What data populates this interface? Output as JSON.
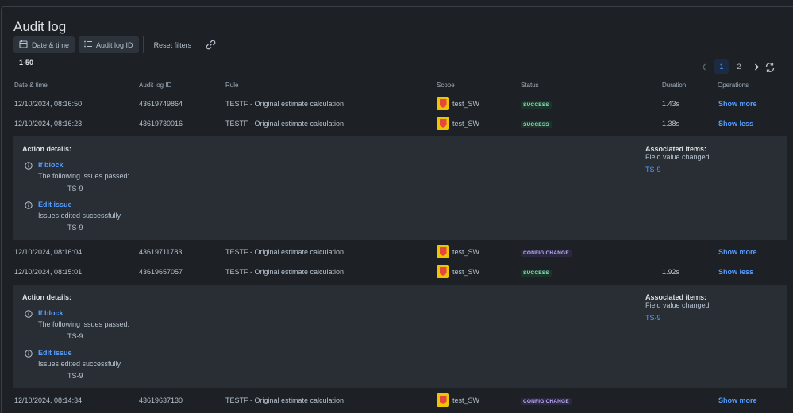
{
  "page_title": "Audit log",
  "toolbar": {
    "date_time_label": "Date & time",
    "audit_id_label": "Audit log ID",
    "reset_label": "Reset filters"
  },
  "range": "1-50",
  "pager": {
    "pages": [
      "1",
      "2"
    ],
    "current": "1"
  },
  "columns": {
    "date": "Date & time",
    "id": "Audit log ID",
    "rule": "Rule",
    "scope": "Scope",
    "status": "Status",
    "duration": "Duration",
    "operations": "Operations"
  },
  "rows": [
    {
      "date": "12/10/2024, 08:16:50",
      "id": "43619749864",
      "rule": "TESTF - Original estimate calculation",
      "scope": "test_SW",
      "status": "SUCCESS",
      "duration": "1.43s",
      "op": "Show more"
    },
    {
      "date": "12/10/2024, 08:16:23",
      "id": "43619730016",
      "rule": "TESTF - Original estimate calculation",
      "scope": "test_SW",
      "status": "SUCCESS",
      "duration": "1.38s",
      "op": "Show less"
    },
    {
      "date": "12/10/2024, 08:16:04",
      "id": "43619711783",
      "rule": "TESTF - Original estimate calculation",
      "scope": "test_SW",
      "status": "CONFIG CHANGE",
      "duration": "",
      "op": "Show more"
    },
    {
      "date": "12/10/2024, 08:15:01",
      "id": "43619657057",
      "rule": "TESTF - Original estimate calculation",
      "scope": "test_SW",
      "status": "SUCCESS",
      "duration": "1.92s",
      "op": "Show less"
    },
    {
      "date": "12/10/2024, 08:14:34",
      "id": "43619637130",
      "rule": "TESTF - Original estimate calculation",
      "scope": "test_SW",
      "status": "CONFIG CHANGE",
      "duration": "",
      "op": "Show more"
    }
  ],
  "details": [
    {
      "action_details_label": "Action details:",
      "block1_title": "If block",
      "block1_text": "The following issues passed:",
      "block1_issue": "TS-9",
      "block2_title": "Edit issue",
      "block2_text": "Issues edited successfully",
      "block2_issue": "TS-9",
      "assoc_label": "Associated items:",
      "assoc_text": "Field value changed",
      "assoc_link": "TS-9"
    },
    {
      "action_details_label": "Action details:",
      "block1_title": "If block",
      "block1_text": "The following issues passed:",
      "block1_issue": "TS-9",
      "block2_title": "Edit issue",
      "block2_text": "Issues edited successfully",
      "block2_issue": "TS-9",
      "assoc_label": "Associated items:",
      "assoc_text": "Field value changed",
      "assoc_link": "TS-9"
    }
  ],
  "colors": {
    "success_bg": "#1c3329",
    "success_fg": "#7ee2b8",
    "config_bg": "#2b273f",
    "config_fg": "#b8acf6",
    "link": "#579dff"
  }
}
